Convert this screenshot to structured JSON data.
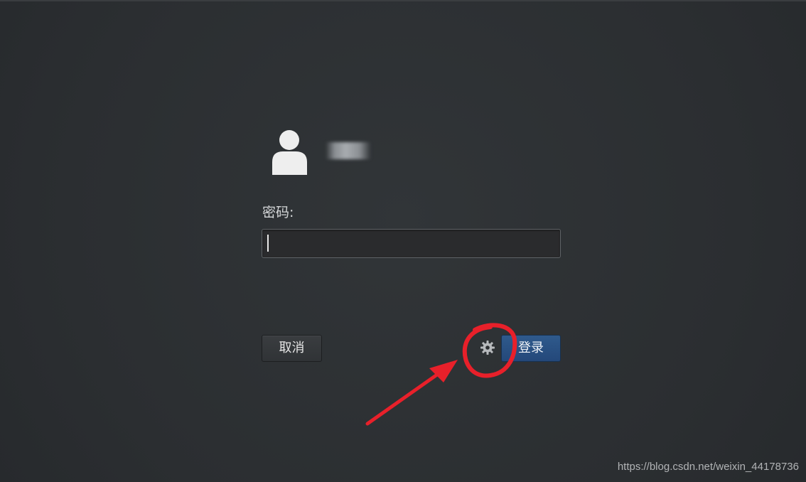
{
  "user": {
    "name": "",
    "avatar_icon": "user-avatar-icon"
  },
  "password": {
    "label": "密码:",
    "value": ""
  },
  "buttons": {
    "cancel_label": "取消",
    "login_label": "登录",
    "settings_icon": "gear-icon"
  },
  "annotation": {
    "color": "#e8202a",
    "shapes": [
      "circle-around-gear",
      "arrow-pointing-to-gear"
    ]
  },
  "watermark": {
    "text": "https://blog.csdn.net/weixin_44178736"
  },
  "colors": {
    "background": "#2c2f32",
    "login_button": "#2a528a",
    "annotation_red": "#e8202a"
  }
}
